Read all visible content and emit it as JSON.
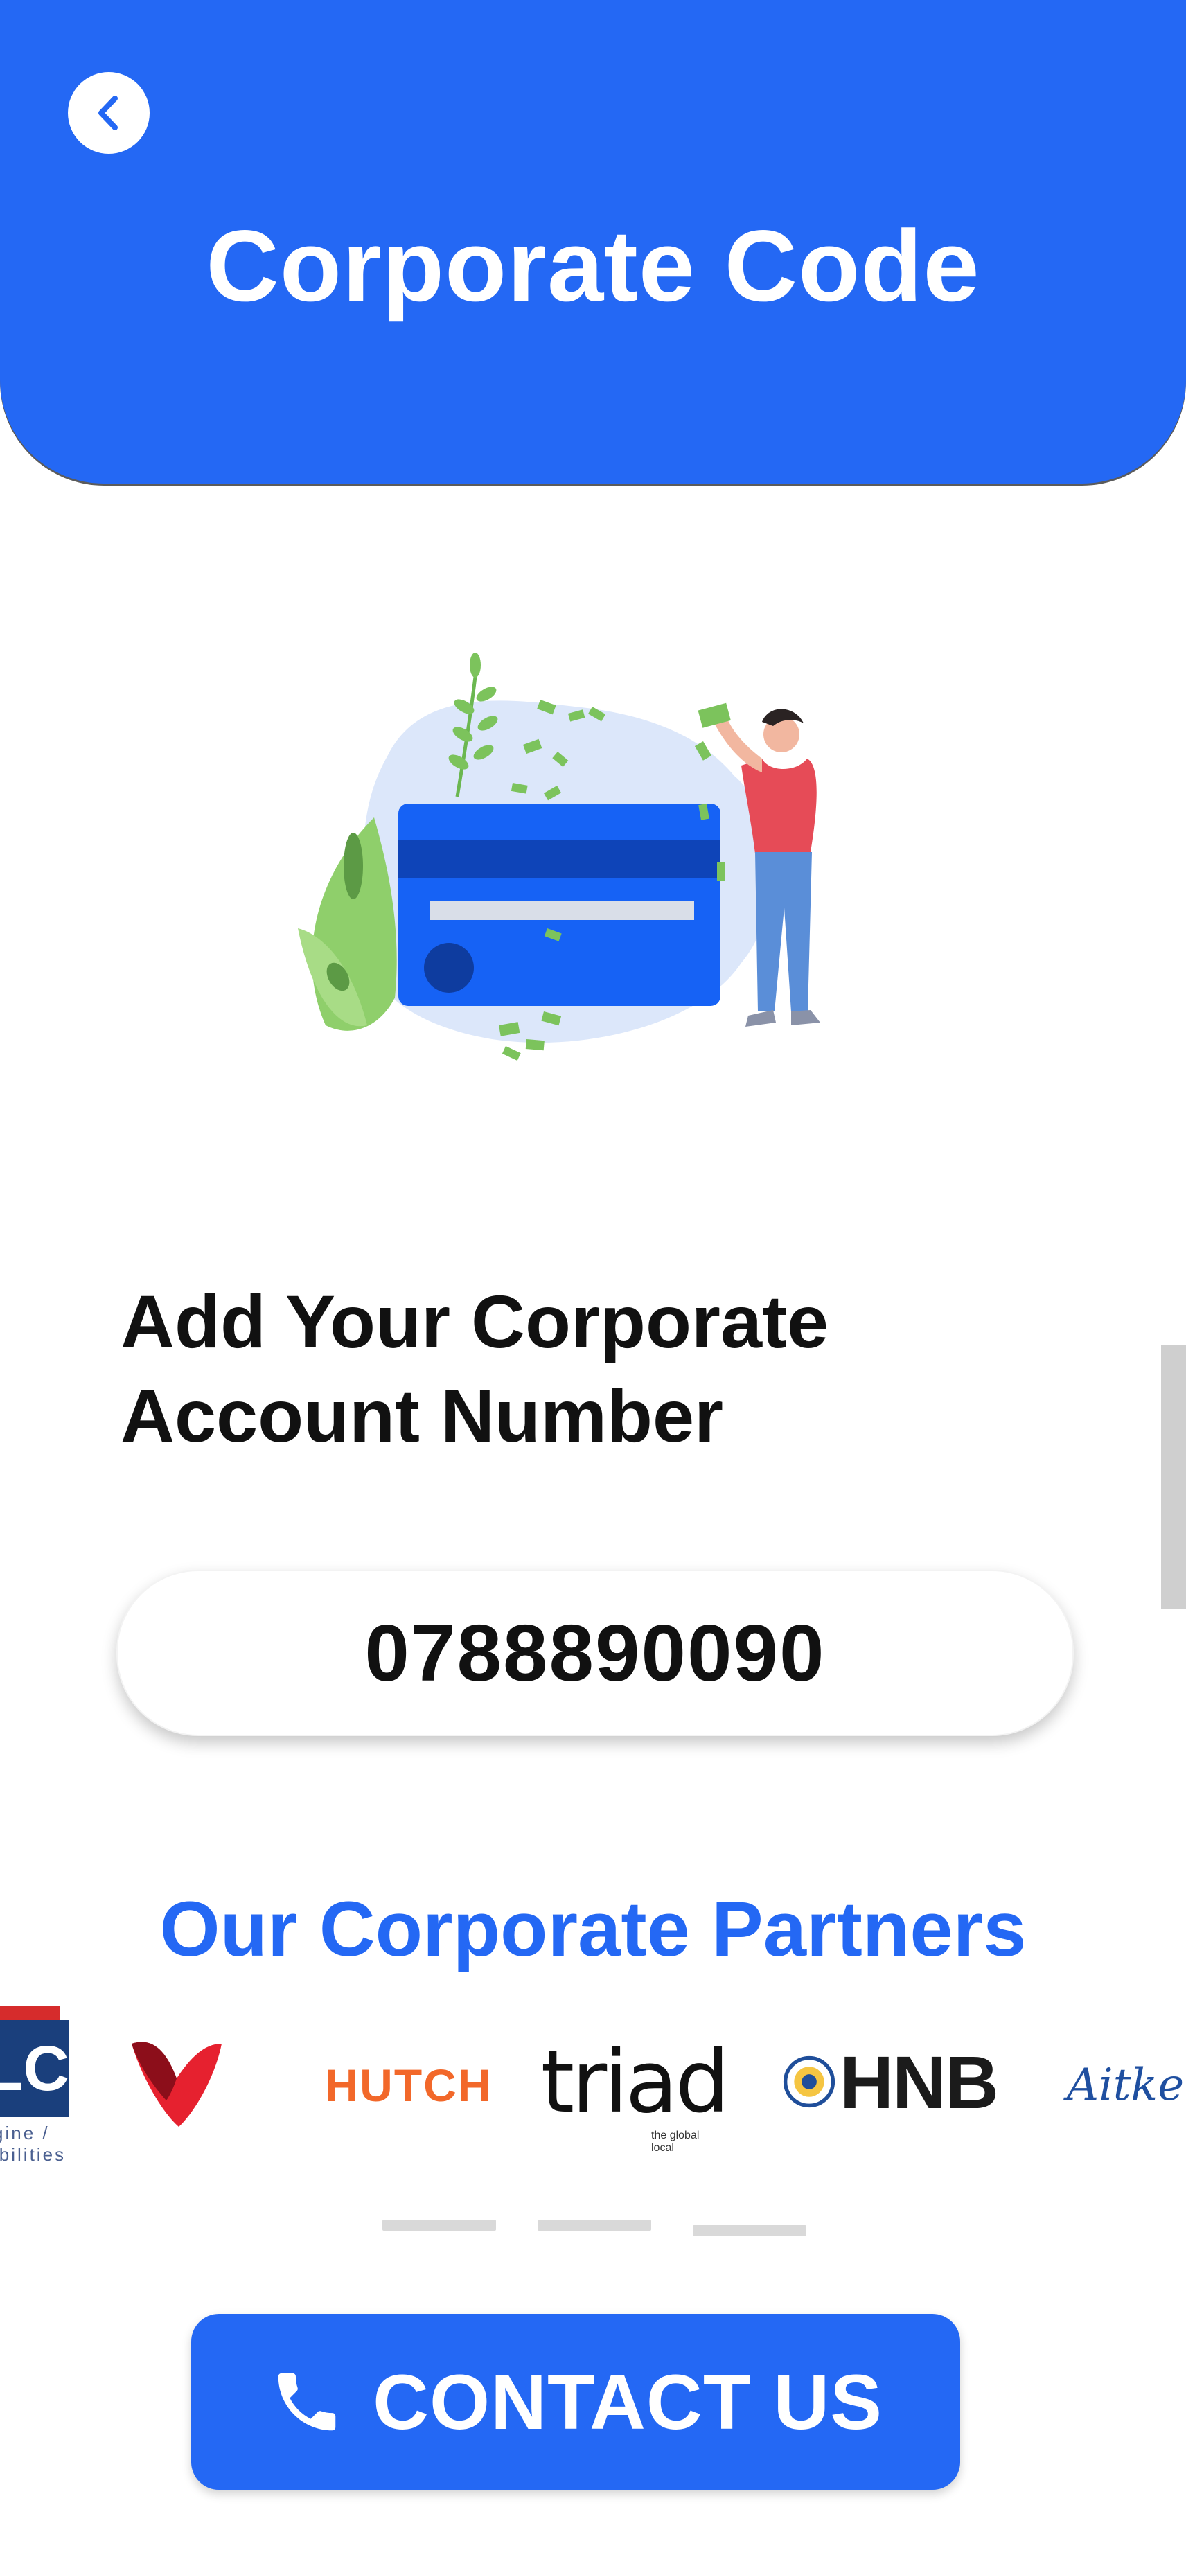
{
  "header": {
    "title": "Corporate Code"
  },
  "form": {
    "heading_line1": "Add Your Corporate",
    "heading_line2": "Account Number",
    "account_number": "0788890090"
  },
  "partners": {
    "title": "Our Corporate Partners",
    "logos": [
      {
        "name": "LC",
        "text": "LC",
        "subtext": "gine / ibilities"
      },
      {
        "name": "V logo"
      },
      {
        "name": "HUTCH",
        "text": "HUTCH"
      },
      {
        "name": "triad",
        "text": "triad",
        "tagline": "the global local"
      },
      {
        "name": "HNB",
        "text": "HNB"
      },
      {
        "name": "Aitken",
        "text": "Aitken"
      }
    ],
    "page_count": 3,
    "active_page_index": 2
  },
  "contact": {
    "label": "CONTACT US",
    "icon": "phone-icon"
  },
  "colors": {
    "primary": "#2468F4",
    "text": "#111111",
    "hutch": "#F2682A"
  }
}
